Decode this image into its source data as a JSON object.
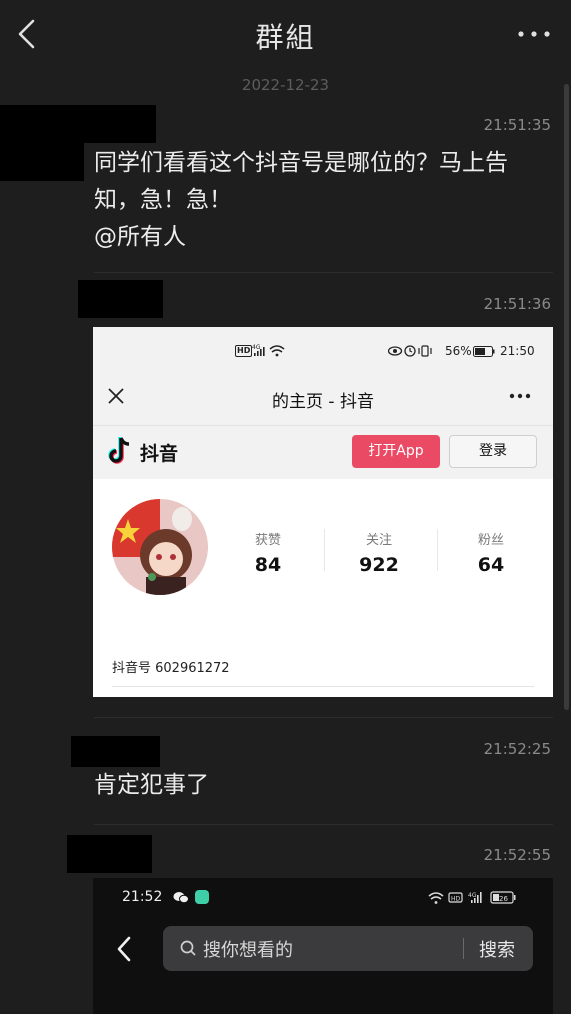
{
  "header": {
    "title": "群組"
  },
  "date_label": "2022-12-23",
  "messages": [
    {
      "time": "21:51:35",
      "lines": [
        "同学们看看这个抖音号是哪位的？马上告",
        "知，急！急！",
        "@所有人"
      ]
    },
    {
      "time": "21:51:36"
    },
    {
      "time": "21:52:25",
      "text": "肯定犯事了"
    },
    {
      "time": "21:52:55"
    }
  ],
  "shot1": {
    "status_time": "21:50",
    "battery": "56%",
    "nav_title": "的主页 - 抖音",
    "brand": "抖音",
    "open_app": "打开App",
    "login": "登录",
    "stats": [
      {
        "label": "获赞",
        "value": "84"
      },
      {
        "label": "关注",
        "value": "922"
      },
      {
        "label": "粉丝",
        "value": "64"
      }
    ],
    "douyin_id": "抖音号 602961272"
  },
  "shot2": {
    "status_time": "21:52",
    "search_placeholder": "搜你想看的",
    "search_button": "搜索"
  },
  "colors": {
    "background": "#1e1e1e",
    "accent": "#ea4a63"
  }
}
